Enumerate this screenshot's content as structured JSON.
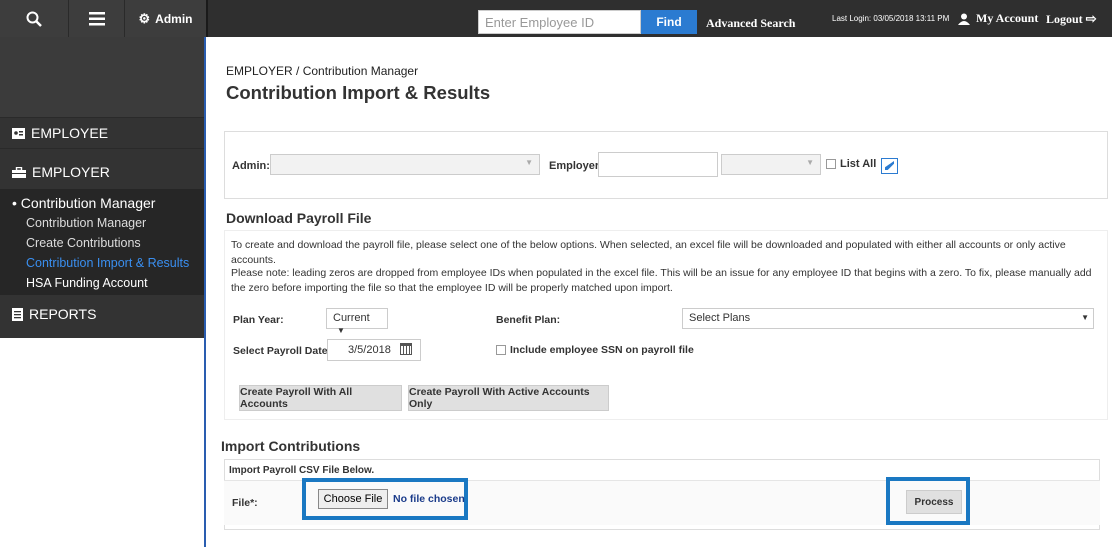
{
  "topbar": {
    "admin_label": "Admin",
    "employee_id_placeholder": "Enter Employee ID",
    "find_label": "Find",
    "advanced_search_label": "Advanced Search",
    "last_login": "Last Login: 03/05/2018 13:11 PM",
    "my_account_label": "My Account",
    "logout_label": "Logout"
  },
  "sidebar": {
    "employee_label": "EMPLOYEE",
    "employer_label": "EMPLOYER",
    "contribution_group": "• Contribution Manager",
    "sub_items": [
      {
        "label": "Contribution Manager"
      },
      {
        "label": "Create Contributions"
      },
      {
        "label": "Contribution Import & Results"
      },
      {
        "label": "HSA Funding Account"
      }
    ],
    "reports_label": "REPORTS"
  },
  "main": {
    "breadcrumb": "EMPLOYER / Contribution Manager",
    "title": "Contribution Import & Results",
    "filters": {
      "admin_label": "Admin:",
      "employer_label": "Employer:",
      "list_all_label": "List All"
    },
    "download": {
      "title": "Download Payroll File",
      "para1": "To create and download the payroll file, please select one of the below options. When selected, an excel file will be downloaded and populated with either all accounts or only active accounts.",
      "para2": "Please note: leading zeros are dropped from employee IDs when populated in the excel file. This will be an issue for any employee ID that begins with a zero. To fix, please manually add the zero before importing the file so that the employee ID will be properly matched upon import.",
      "plan_year_label": "Plan Year:",
      "plan_year_value": "Current",
      "benefit_plan_label": "Benefit Plan:",
      "benefit_plan_value": "Select Plans",
      "payroll_date_label": "Select Payroll Date:",
      "payroll_date_value": "3/5/2018",
      "include_ssn_label": "Include employee SSN on payroll file",
      "btn_all": "Create Payroll With All Accounts",
      "btn_active": "Create Payroll With Active Accounts Only"
    },
    "import": {
      "title": "Import Contributions",
      "subtitle": "Import Payroll CSV File Below.",
      "file_label": "File*:",
      "choose_file_label": "Choose File",
      "no_file_label": "No file chosen",
      "process_label": "Process"
    }
  },
  "colors": {
    "topbar_bg": "#2f2f2f",
    "sidebar_bg": "#333333",
    "accent_blue": "#2b7bd1",
    "highlight_box": "#1a78c2"
  }
}
